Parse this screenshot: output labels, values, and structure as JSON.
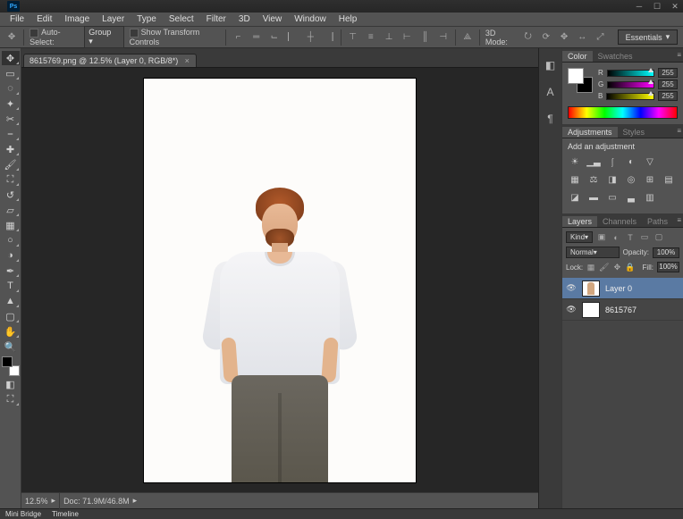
{
  "window": {
    "app_abbr": "Ps"
  },
  "menu": [
    "File",
    "Edit",
    "Image",
    "Layer",
    "Type",
    "Select",
    "Filter",
    "3D",
    "View",
    "Window",
    "Help"
  ],
  "options": {
    "auto_select": "Auto-Select:",
    "group": "Group",
    "show_transform": "Show Transform Controls",
    "mode_3d": "3D Mode:"
  },
  "workspace": {
    "label": "Essentials"
  },
  "document": {
    "tab_title": "8615769.png @ 12.5% (Layer 0, RGB/8*)",
    "zoom": "12.5%",
    "doc_size": "Doc: 71.9M/46.8M"
  },
  "panels": {
    "color_tab": "Color",
    "swatches_tab": "Swatches",
    "rgb": {
      "r_label": "R",
      "g_label": "G",
      "b_label": "B",
      "r": "255",
      "g": "255",
      "b": "255"
    },
    "adjustments_tab": "Adjustments",
    "styles_tab": "Styles",
    "adjust_title": "Add an adjustment",
    "layers_tab": "Layers",
    "channels_tab": "Channels",
    "paths_tab": "Paths",
    "kind_label": "Kind",
    "blend_mode": "Normal",
    "opacity_label": "Opacity:",
    "opacity_val": "100%",
    "lock_label": "Lock:",
    "fill_label": "Fill:",
    "fill_val": "100%",
    "layers": [
      {
        "name": "Layer 0",
        "selected": true
      },
      {
        "name": "8615767",
        "selected": false
      }
    ]
  },
  "bottom": {
    "mini_bridge": "Mini Bridge",
    "timeline": "Timeline"
  }
}
